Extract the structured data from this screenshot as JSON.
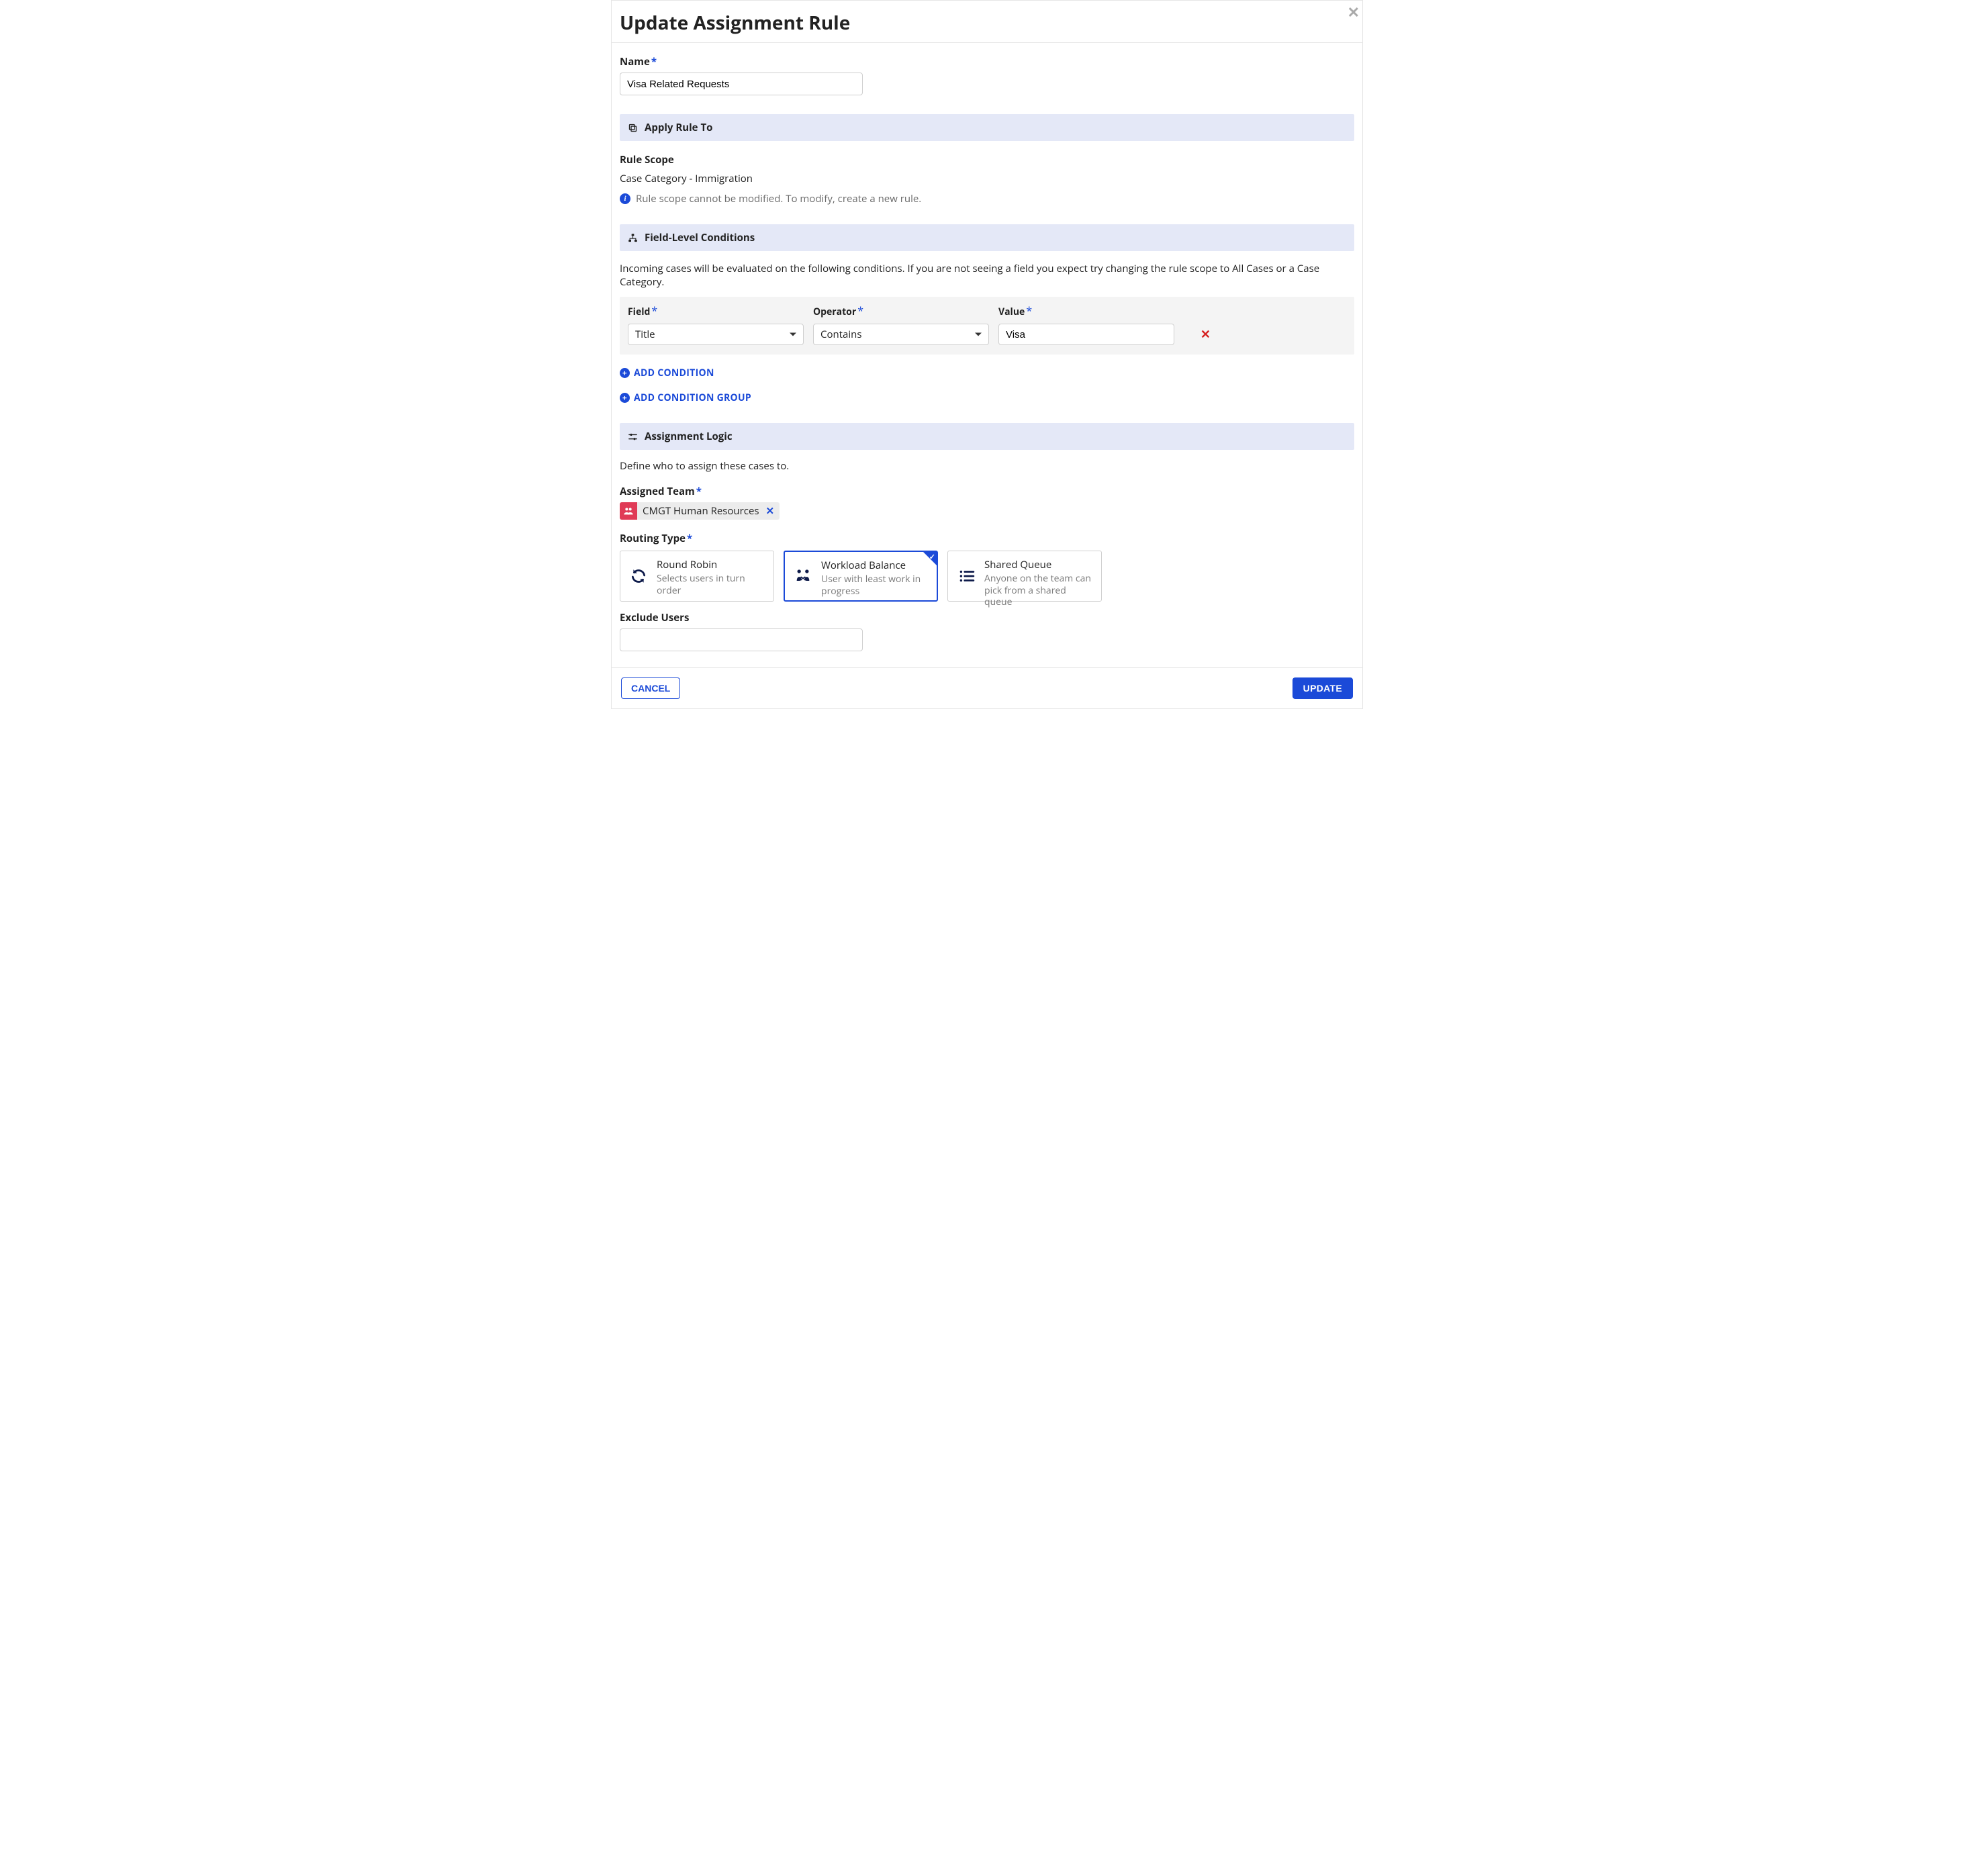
{
  "header": {
    "title": "Update Assignment Rule"
  },
  "name_section": {
    "label": "Name",
    "required_mark": "*",
    "value": "Visa Related Requests"
  },
  "apply_rule": {
    "section_title": "Apply Rule To",
    "scope_label": "Rule Scope",
    "scope_value": "Case Category - Immigration",
    "info_text": "Rule scope cannot be modified. To modify, create a new rule."
  },
  "field_conditions": {
    "section_title": "Field-Level Conditions",
    "hint": "Incoming cases will be evaluated on the following conditions. If you are not seeing a field you expect try changing the rule scope to All Cases or a Case Category.",
    "columns": {
      "field": "Field",
      "operator": "Operator",
      "value": "Value",
      "required_mark": "*"
    },
    "rows": [
      {
        "field": "Title",
        "operator": "Contains",
        "value": "Visa"
      }
    ],
    "add_condition_label": "ADD CONDITION",
    "add_group_label": "ADD CONDITION GROUP"
  },
  "assignment_logic": {
    "section_title": "Assignment Logic",
    "intro": "Define who to assign these cases to.",
    "assigned_team_label": "Assigned Team",
    "required_mark": "*",
    "assigned_team": {
      "name": "CMGT Human Resources"
    },
    "routing_type_label": "Routing Type",
    "routing_options": [
      {
        "id": "round-robin",
        "title": "Round Robin",
        "desc": "Selects users in turn order",
        "selected": false
      },
      {
        "id": "workload-balance",
        "title": "Workload Balance",
        "desc": "User with least work in progress",
        "selected": true
      },
      {
        "id": "shared-queue",
        "title": "Shared Queue",
        "desc": "Anyone on the team can pick from a shared queue",
        "selected": false
      }
    ],
    "exclude_users_label": "Exclude Users"
  },
  "footer": {
    "cancel": "CANCEL",
    "update": "UPDATE"
  }
}
